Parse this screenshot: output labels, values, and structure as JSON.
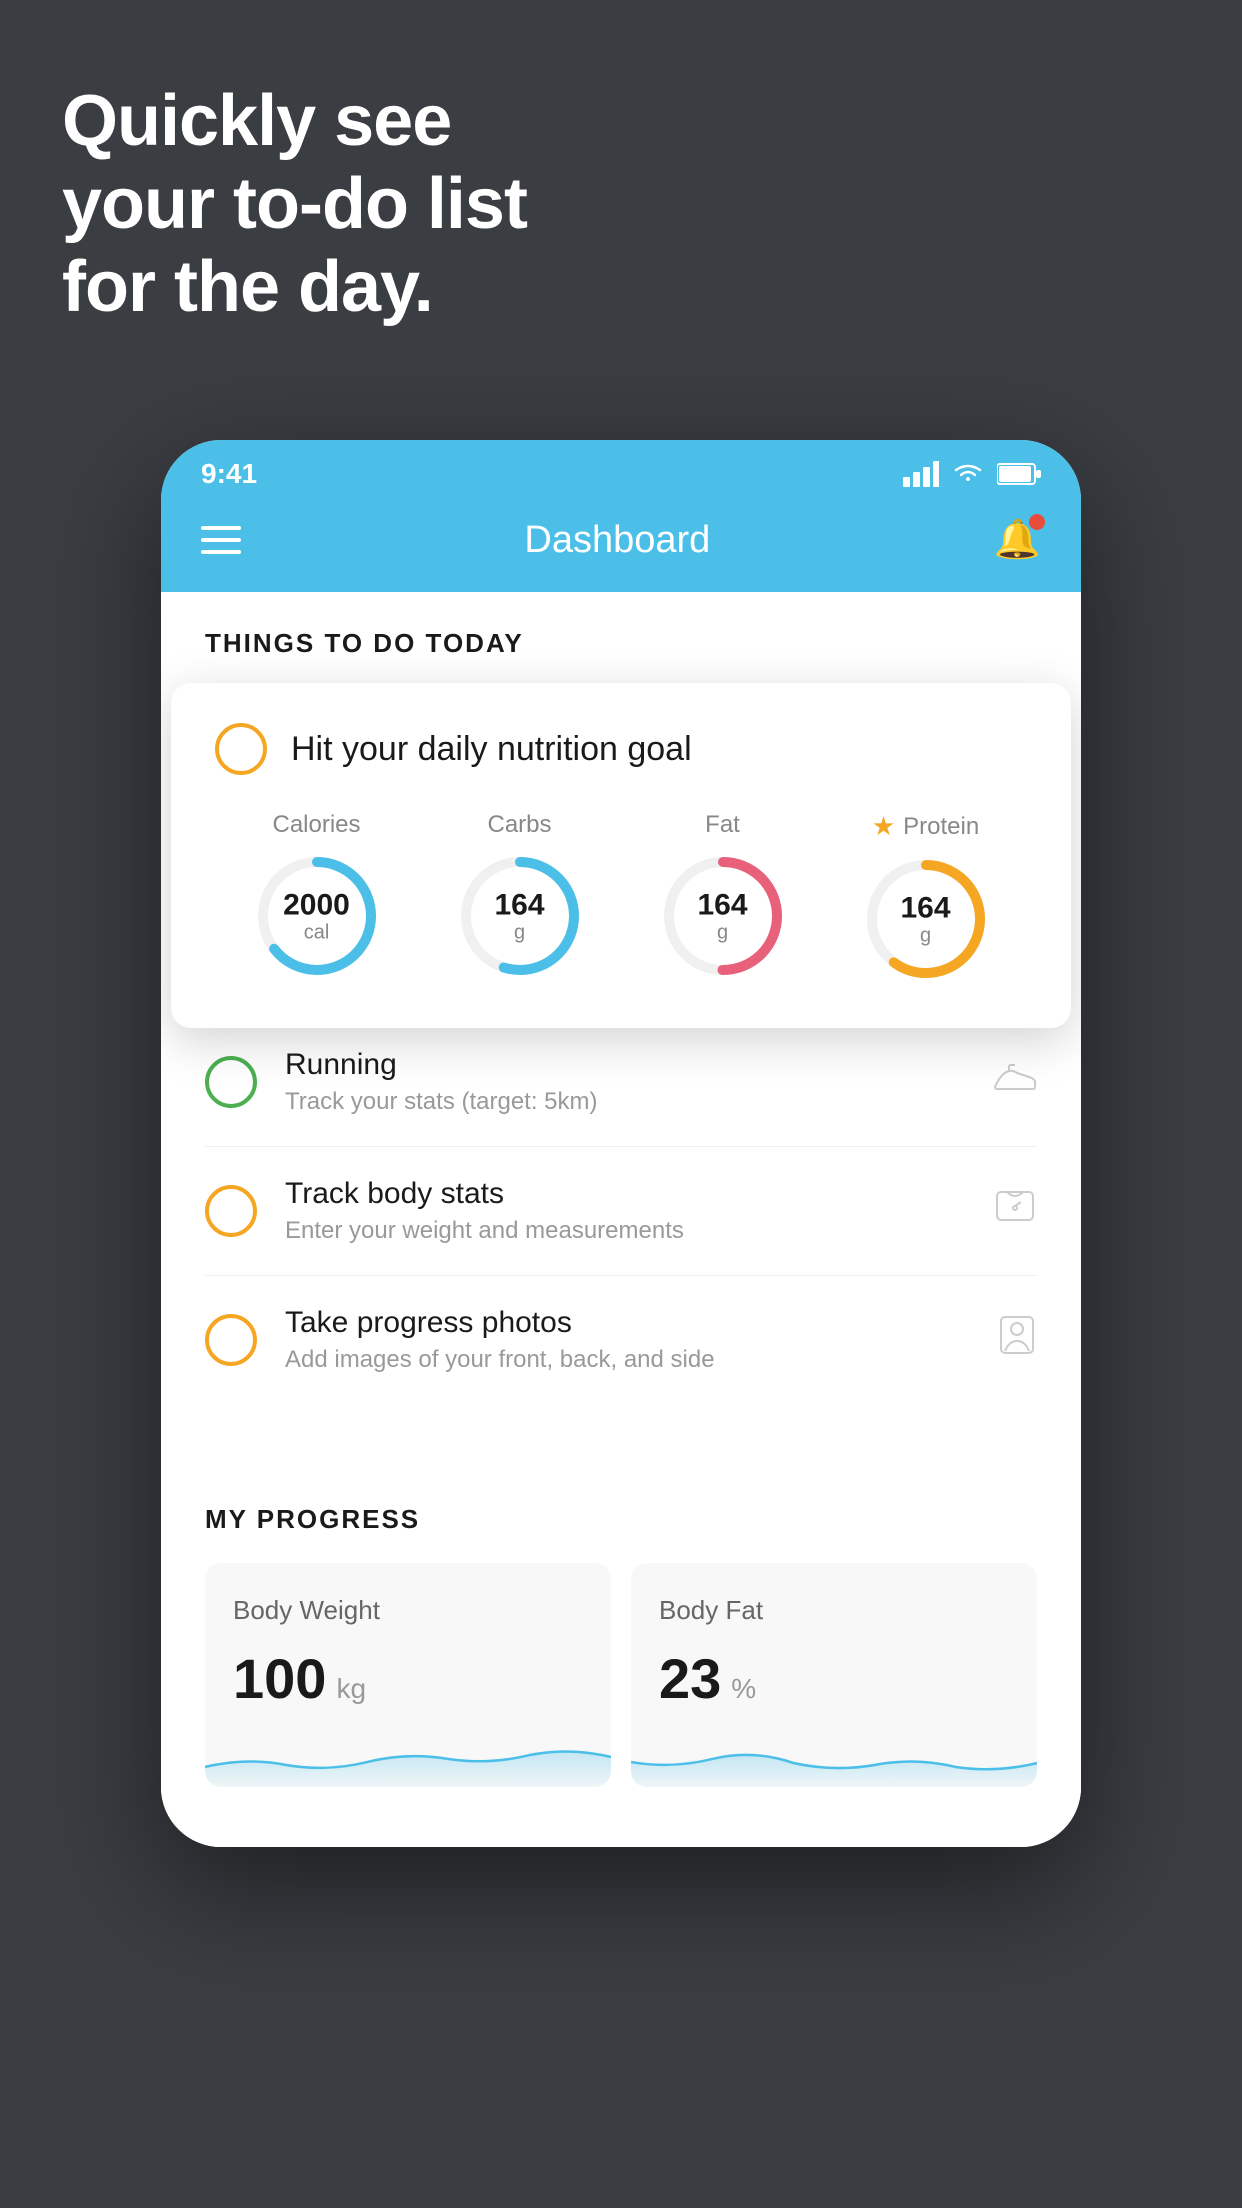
{
  "hero": {
    "line1": "Quickly see",
    "line2": "your to-do list",
    "line3": "for the day."
  },
  "status_bar": {
    "time": "9:41"
  },
  "header": {
    "title": "Dashboard"
  },
  "things_section": {
    "label": "THINGS TO DO TODAY"
  },
  "nutrition_card": {
    "checkbox_color": "yellow",
    "title": "Hit your daily nutrition goal",
    "macros": [
      {
        "label": "Calories",
        "value": "2000",
        "unit": "cal",
        "color": "#4bbfe8",
        "percent": 65,
        "starred": false
      },
      {
        "label": "Carbs",
        "value": "164",
        "unit": "g",
        "color": "#4bbfe8",
        "percent": 55,
        "starred": false
      },
      {
        "label": "Fat",
        "value": "164",
        "unit": "g",
        "color": "#e8607a",
        "percent": 50,
        "starred": false
      },
      {
        "label": "Protein",
        "value": "164",
        "unit": "g",
        "color": "#f5a623",
        "percent": 60,
        "starred": true
      }
    ]
  },
  "todo_items": [
    {
      "id": "running",
      "checkbox_color": "green",
      "title": "Running",
      "subtitle": "Track your stats (target: 5km)",
      "icon": "shoe"
    },
    {
      "id": "body-stats",
      "checkbox_color": "yellow",
      "title": "Track body stats",
      "subtitle": "Enter your weight and measurements",
      "icon": "scale"
    },
    {
      "id": "progress-photos",
      "checkbox_color": "yellow",
      "title": "Take progress photos",
      "subtitle": "Add images of your front, back, and side",
      "icon": "person"
    }
  ],
  "progress_section": {
    "title": "MY PROGRESS",
    "cards": [
      {
        "id": "body-weight",
        "title": "Body Weight",
        "value": "100",
        "unit": "kg"
      },
      {
        "id": "body-fat",
        "title": "Body Fat",
        "value": "23",
        "unit": "%"
      }
    ]
  }
}
